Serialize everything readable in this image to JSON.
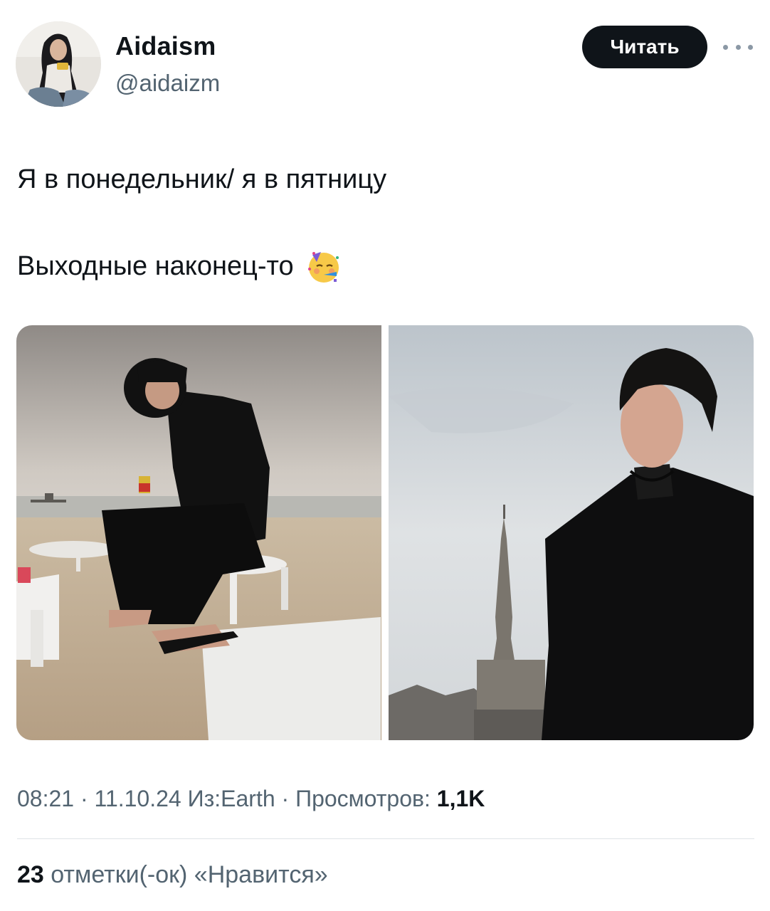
{
  "author": {
    "display_name": "Aidaism",
    "handle": "@aidaizm"
  },
  "follow_label": "Читать",
  "tweet": {
    "line1": "Я в понедельник/ я в пятницу",
    "line2": "Выходные наконец-то",
    "emoji": "partying-face-emoji"
  },
  "meta": {
    "time": "08:21",
    "sep1": " · ",
    "date": "11.10.24",
    "source": " Из:Earth",
    "sep2": " · ",
    "views_label": "Просмотров: ",
    "views_count": "1,1K"
  },
  "likes": {
    "count": "23",
    "label": " отметки(-ок) «Нравится»"
  },
  "colors": {
    "text": "#0f1419",
    "secondary": "#536471",
    "button_bg": "#0f1419",
    "divider": "#dfe3e6"
  }
}
